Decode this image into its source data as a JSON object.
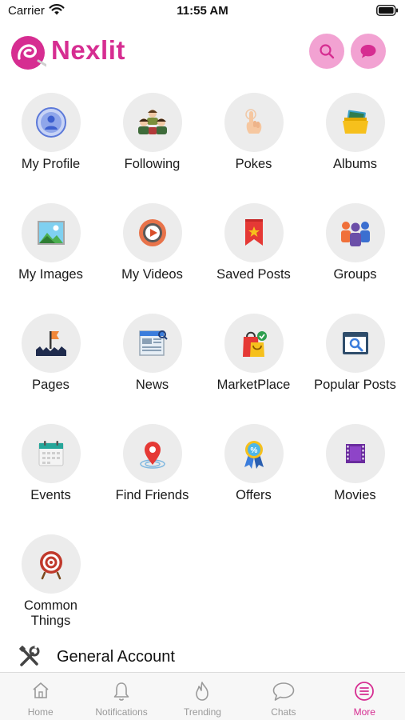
{
  "status_bar": {
    "carrier": "Carrier",
    "time": "11:55 AM"
  },
  "header": {
    "logo_text": "Nexlit"
  },
  "menu": [
    {
      "label": "My Profile",
      "icon": "profile-icon"
    },
    {
      "label": "Following",
      "icon": "following-icon"
    },
    {
      "label": "Pokes",
      "icon": "poke-icon"
    },
    {
      "label": "Albums",
      "icon": "albums-icon"
    },
    {
      "label": "My Images",
      "icon": "images-icon"
    },
    {
      "label": "My Videos",
      "icon": "videos-icon"
    },
    {
      "label": "Saved Posts",
      "icon": "saved-posts-icon"
    },
    {
      "label": "Groups",
      "icon": "groups-icon"
    },
    {
      "label": "Pages",
      "icon": "pages-icon"
    },
    {
      "label": "News",
      "icon": "news-icon"
    },
    {
      "label": "MarketPlace",
      "icon": "marketplace-icon"
    },
    {
      "label": "Popular Posts",
      "icon": "popular-posts-icon"
    },
    {
      "label": "Events",
      "icon": "events-icon"
    },
    {
      "label": "Find Friends",
      "icon": "find-friends-icon"
    },
    {
      "label": "Offers",
      "icon": "offers-icon"
    },
    {
      "label": "Movies",
      "icon": "movies-icon"
    },
    {
      "label": "Common Things",
      "icon": "common-things-icon"
    }
  ],
  "section": {
    "general_account": "General Account"
  },
  "tab_bar": {
    "tabs": [
      {
        "label": "Home",
        "icon": "home-icon",
        "active": false
      },
      {
        "label": "Notifications",
        "icon": "bell-icon",
        "active": false
      },
      {
        "label": "Trending",
        "icon": "flame-icon",
        "active": false
      },
      {
        "label": "Chats",
        "icon": "chat-bubble-icon",
        "active": false
      },
      {
        "label": "More",
        "icon": "menu-icon",
        "active": true
      }
    ]
  },
  "colors": {
    "brand": "#d62d91",
    "header_button_bg": "#f2a2d2",
    "tile_bg": "#ececec",
    "inactive_tab": "#9a9a9a"
  }
}
